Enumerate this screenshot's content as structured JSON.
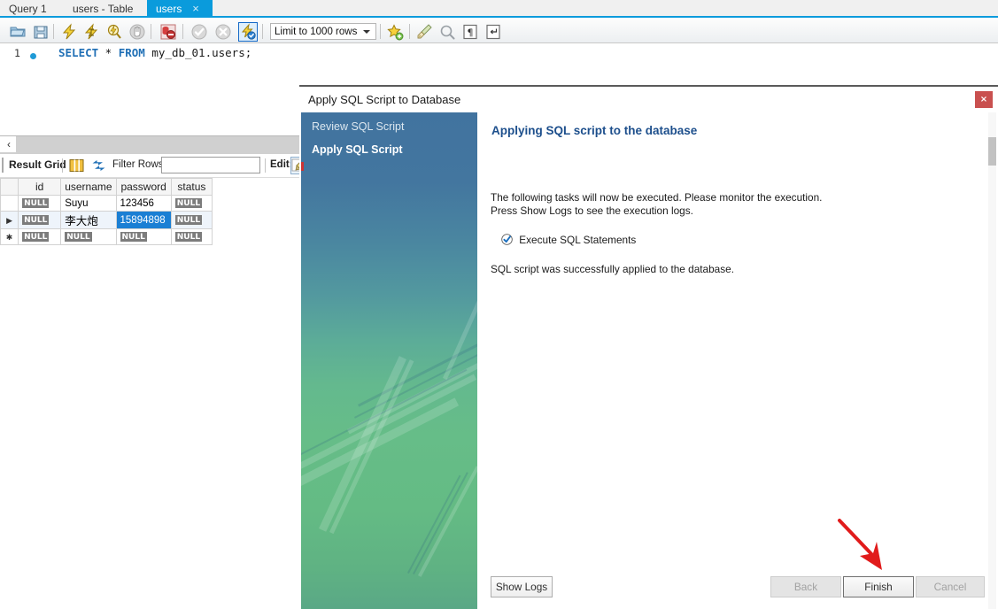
{
  "tabs": [
    {
      "label": "Query 1",
      "active": false,
      "closable": false
    },
    {
      "label": "users - Table",
      "active": false,
      "closable": false
    },
    {
      "label": "users",
      "active": true,
      "closable": true,
      "close_glyph": "×"
    }
  ],
  "toolbar": {
    "icons": [
      {
        "name": "open-script-icon",
        "title": "Open a script file in this editor"
      },
      {
        "name": "save-script-icon",
        "title": "Save the script to a file"
      },
      {
        "name": "execute-statement-icon",
        "title": "Execute the selected portion of the script"
      },
      {
        "name": "execute-current-statement-icon",
        "title": "Execute the statement under the keyboard cursor"
      },
      {
        "name": "explain-statement-icon",
        "title": "Execute the explain command on the statement"
      },
      {
        "name": "stop-icon",
        "title": "Stop the query being executed"
      },
      {
        "name": "toggle-stop-on-error-icon",
        "title": "Toggle whether execution should stop on errors"
      },
      {
        "name": "commit-icon",
        "title": "Commit the current transaction"
      },
      {
        "name": "rollback-icon",
        "title": "Rollback the current transaction"
      },
      {
        "name": "auto-commit-icon",
        "title": "Toggle auto-commit mode",
        "selected": true
      }
    ],
    "limit_label": "Limit to 1000 rows",
    "right_icons": [
      {
        "name": "save-snippet-icon"
      },
      {
        "name": "beautify-sql-icon"
      },
      {
        "name": "find-icon"
      },
      {
        "name": "toggle-invisible-chars-icon",
        "glyph": "¶"
      },
      {
        "name": "wrap-lines-icon",
        "glyph": "↵"
      }
    ]
  },
  "editor": {
    "line_number": "1",
    "sql_keyword_1": "SELECT",
    "sql_star": " * ",
    "sql_keyword_2": "FROM",
    "sql_table": " my_db_01.users;"
  },
  "result_bar": {
    "title": "Result Grid",
    "filter_label": "Filter Rows:",
    "filter_value": "",
    "filter_placeholder": "",
    "edit_label": "Edit:",
    "grid_icon_name": "field-types-icon",
    "refresh_icon_name": "refresh-icon",
    "edit_icon_name": "edit-row-icon"
  },
  "grid": {
    "columns": [
      "",
      "id",
      "username",
      "password",
      "status"
    ],
    "rows": [
      {
        "marker": "",
        "selected": false,
        "cells": [
          {
            "value": "NULL",
            "null": true
          },
          {
            "value": "Suyu",
            "null": false
          },
          {
            "value": "123456",
            "null": false
          },
          {
            "value": "NULL",
            "null": true
          }
        ]
      },
      {
        "marker": "▶",
        "selected": true,
        "cells": [
          {
            "value": "NULL",
            "null": true
          },
          {
            "value": "李大炮",
            "null": false,
            "cjk": true
          },
          {
            "value": "15894898",
            "null": false,
            "highlighted": true
          },
          {
            "value": "NULL",
            "null": true
          }
        ]
      },
      {
        "marker": "✱",
        "selected": false,
        "cells": [
          {
            "value": "NULL",
            "null": true
          },
          {
            "value": "NULL",
            "null": true
          },
          {
            "value": "NULL",
            "null": true
          },
          {
            "value": "NULL",
            "null": true
          }
        ]
      }
    ]
  },
  "dialog": {
    "title": "Apply SQL Script to Database",
    "close_glyph": "×",
    "sidebar_steps": [
      {
        "label": "Review SQL Script",
        "active": false
      },
      {
        "label": "Apply SQL Script",
        "active": true
      }
    ],
    "heading": "Applying SQL script to the database",
    "paragraph": "The following tasks will now be executed. Please monitor the execution.\nPress Show Logs to see the execution logs.",
    "task_label": "Execute SQL Statements",
    "task_checked": true,
    "result_message": "SQL script was successfully applied to the database.",
    "buttons": {
      "show_logs": "Show Logs",
      "back": "Back",
      "finish": "Finish",
      "cancel": "Cancel",
      "back_disabled": true,
      "finish_disabled": false,
      "cancel_disabled": true
    }
  },
  "annotation": {
    "arrow_color": "#e11b1b",
    "points_to": "finish-button"
  },
  "colors": {
    "accent_tab": "#0a9bdc",
    "heading_blue": "#1d4f8c",
    "selection_blue": "#1a7fd4",
    "close_red": "#c9504f",
    "null_badge_gray": "#7c7c7c",
    "sidebar_top": "#41739f",
    "sidebar_bottom": "#64bb84"
  }
}
